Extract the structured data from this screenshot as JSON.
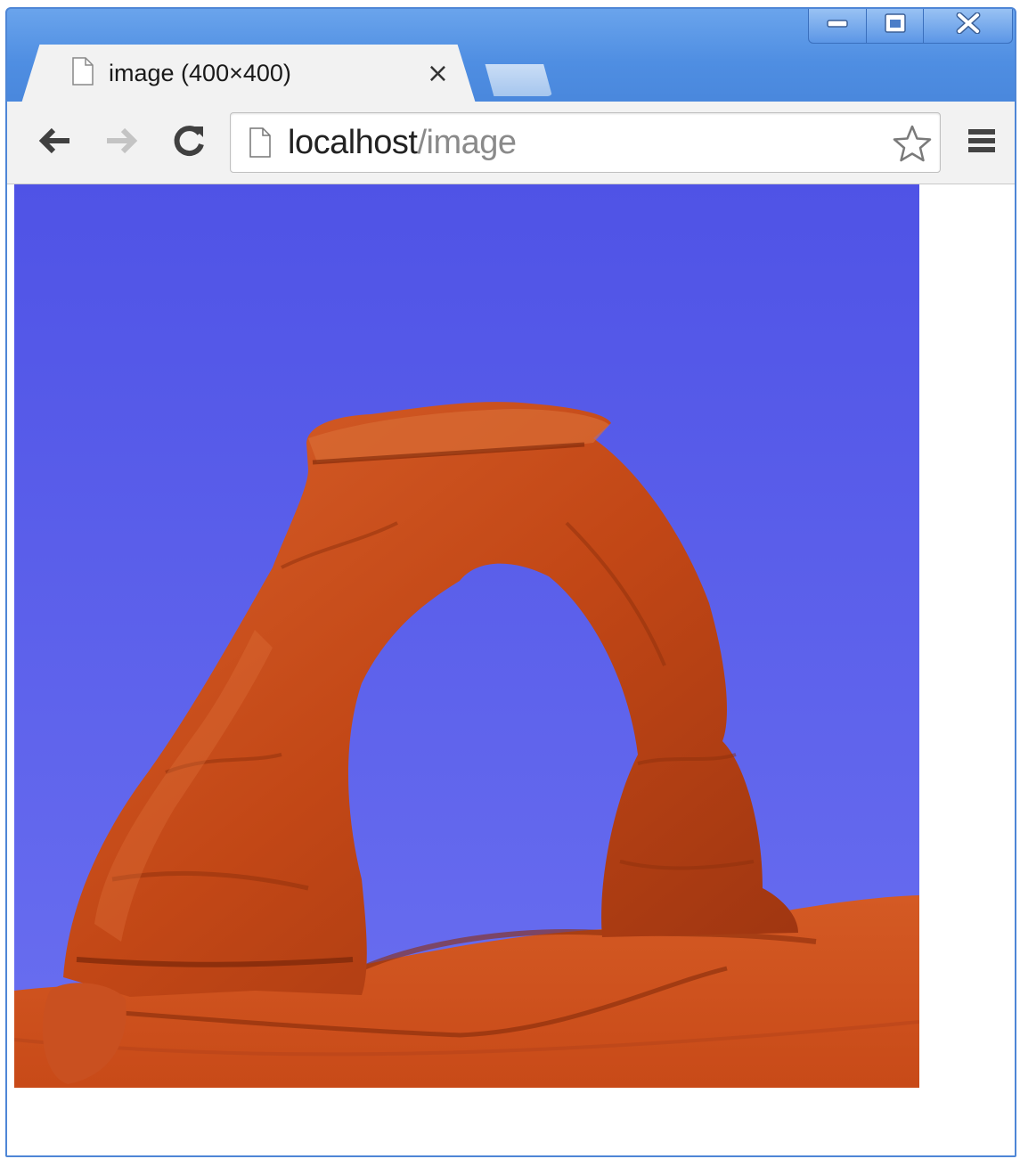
{
  "window": {
    "caption_buttons": {
      "minimize_icon": "minimize-icon",
      "maximize_icon": "maximize-icon",
      "close_icon": "close-window-icon"
    }
  },
  "tab": {
    "title": "image (400×400)",
    "close_glyph": "×",
    "icon": "page-icon"
  },
  "toolbar": {
    "back_icon": "back-arrow-icon",
    "forward_icon": "forward-arrow-icon",
    "reload_icon": "reload-icon",
    "bookmark_icon": "star-icon",
    "menu_icon": "hamburger-menu-icon"
  },
  "address_bar": {
    "host": "localhost",
    "path": "/image"
  },
  "colors": {
    "window_frame": "#4f8ee2",
    "sky": "#5a5ee8",
    "rock": "#c4481a"
  }
}
